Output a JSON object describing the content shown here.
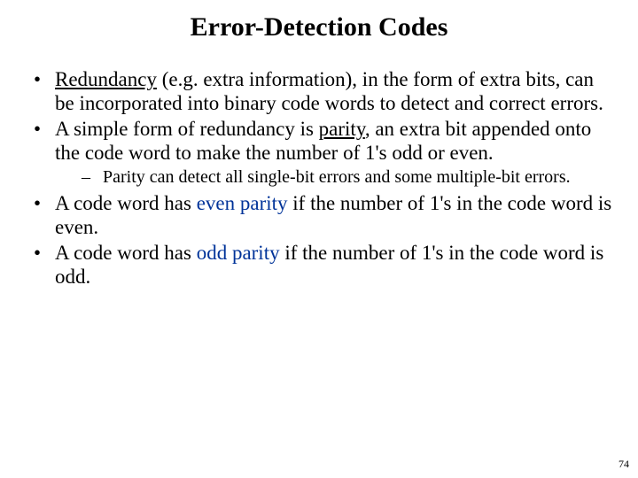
{
  "title": "Error-Detection Codes",
  "bullets": {
    "b1": {
      "underlined": "Redundancy",
      "rest": " (e.g. extra information), in the form of extra bits, can be incorporated into binary code words to detect and correct errors."
    },
    "b2": {
      "pre": "A simple form of redundancy is ",
      "underlined": "parity",
      "post": ", an extra bit appended onto the code word to make the number of 1's odd or even."
    },
    "b2_sub1": "Parity can detect all single-bit errors and some multiple-bit errors.",
    "b3": {
      "pre": "A code word has ",
      "keyword": "even parity",
      "post": " if the number of 1's in the code word is even."
    },
    "b4": {
      "pre": "A code word has ",
      "keyword": "odd parity",
      "post": " if the number of 1's in the code word is odd."
    }
  },
  "page_number": "74"
}
